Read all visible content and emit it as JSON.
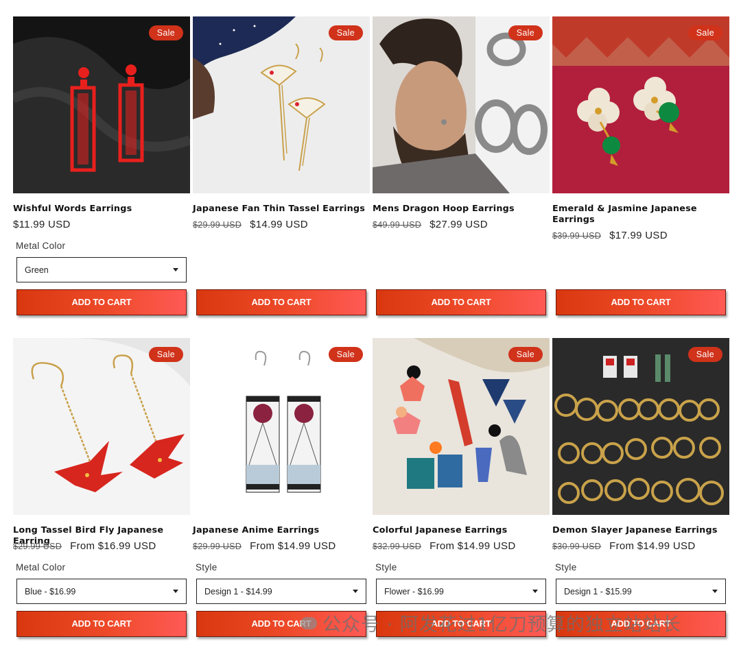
{
  "sale_badge": "Sale",
  "add_to_cart": "ADD TO CART",
  "products": [
    {
      "title": "Wishful Words Earrings",
      "old_price": "",
      "price": "$11.99 USD",
      "option_label": "Metal Color",
      "option_value": "Green"
    },
    {
      "title": "Japanese Fan Thin Tassel Earrings",
      "old_price": "$29.99 USD",
      "price": "$14.99 USD",
      "option_label": "",
      "option_value": ""
    },
    {
      "title": "Mens Dragon Hoop Earrings",
      "old_price": "$49.99 USD",
      "price": "$27.99 USD",
      "option_label": "",
      "option_value": ""
    },
    {
      "title": "Emerald & Jasmine Japanese Earrings",
      "old_price": "$39.99 USD",
      "price": "$17.99 USD",
      "option_label": "",
      "option_value": ""
    },
    {
      "title": "Long Tassel Bird Fly Japanese Earring",
      "old_price": "$29.99 USD",
      "price": "From $16.99 USD",
      "option_label": "Metal Color",
      "option_value": "Blue  -  $16.99"
    },
    {
      "title": "Japanese Anime Earrings",
      "old_price": "$29.99 USD",
      "price": "From $14.99 USD",
      "option_label": "Style",
      "option_value": "Design 1  -  $14.99"
    },
    {
      "title": "Colorful Japanese Earrings",
      "old_price": "$32.99 USD",
      "price": "From $14.99 USD",
      "option_label": "Style",
      "option_value": "Flower  -  $16.99"
    },
    {
      "title": "Demon Slayer Japanese Earrings",
      "old_price": "$30.99 USD",
      "price": "From $14.99 USD",
      "option_label": "Style",
      "option_value": "Design 1  -  $15.99"
    }
  ],
  "watermark": "公众号 · 阿发花过1亿刀预算的独立站站长",
  "colors": {
    "sale_badge": "#d0321a",
    "button_start": "#d9380f",
    "button_end": "#ff5a55"
  }
}
